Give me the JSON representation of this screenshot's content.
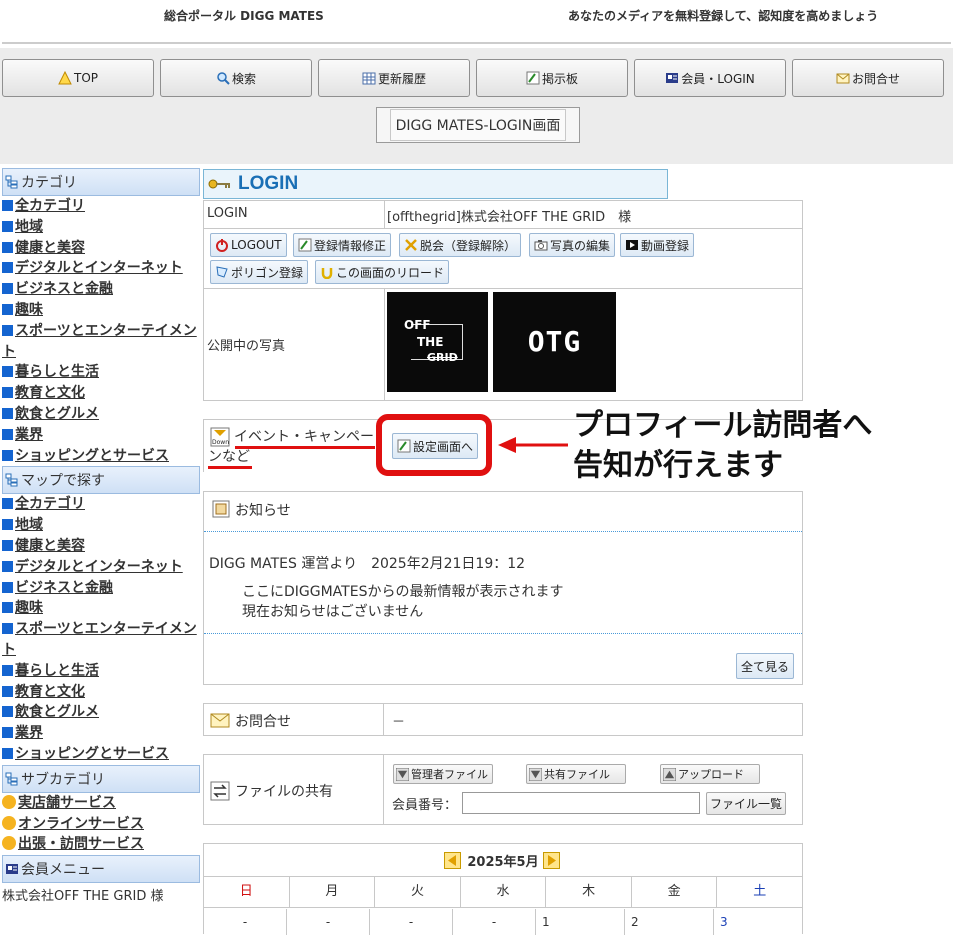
{
  "banner": {
    "left": "総合ポータル DIGG MATES",
    "right": "あなたのメディアを無料登録して、認知度を高めましょう"
  },
  "nav": [
    {
      "label": "TOP",
      "icon": "warning-triangle-icon"
    },
    {
      "label": "検索",
      "icon": "search-icon"
    },
    {
      "label": "更新履歴",
      "icon": "calendar-grid-icon"
    },
    {
      "label": "掲示板",
      "icon": "pencil-board-icon"
    },
    {
      "label": "会員・LOGIN",
      "icon": "id-card-icon"
    },
    {
      "label": "お問合せ",
      "icon": "envelope-icon"
    }
  ],
  "page_title": "DIGG MATES-LOGIN画面",
  "sidebar": {
    "category_head": "カテゴリ",
    "categories": [
      "全カテゴリ",
      "地域",
      "健康と美容",
      "デジタルとインターネット",
      "ビジネスと金融",
      "趣味",
      "スポーツとエンターテイメント",
      "暮らしと生活",
      "教育と文化",
      "飲食とグルメ",
      "業界",
      "ショッピングとサービス"
    ],
    "map_head": "マップで探す",
    "map_categories": [
      "全カテゴリ",
      "地域",
      "健康と美容",
      "デジタルとインターネット",
      "ビジネスと金融",
      "趣味",
      "スポーツとエンターテイメント",
      "暮らしと生活",
      "教育と文化",
      "飲食とグルメ",
      "業界",
      "ショッピングとサービス"
    ],
    "sub_head": "サブカテゴリ",
    "sub_categories": [
      "実店舗サービス",
      "オンラインサービス",
      "出張・訪問サービス"
    ],
    "member_head": "会員メニュー",
    "member_text": "株式会社OFF THE GRID 様"
  },
  "login": {
    "head": "LOGIN",
    "row_label": "LOGIN",
    "row_value": "[offthegrid]株式会社OFF THE GRID　様",
    "buttons": [
      "LOGOUT",
      "登録情報修正",
      "脱会（登録解除）",
      "写真の編集",
      "動画登録",
      "ポリゴン登録",
      "この画面のリロード"
    ],
    "photos_label": "公開中の写真",
    "photo1_text": [
      "OFF",
      "THE",
      "GRID"
    ],
    "photo2_text": "OTG"
  },
  "event": {
    "label": "イベント・キャンペーンなど",
    "label_line1": "イベント・キャンペー",
    "label_line2": "ンなど",
    "button": "設定画面へ",
    "callout_line1": "プロフィール訪問者へ",
    "callout_line2": "告知が行えます"
  },
  "notice": {
    "head": "お知らせ",
    "from": "DIGG MATES 運営より　2025年2月21日19：12",
    "line1": "ここにDIGGMATESからの最新情報が表示されます",
    "line2": "現在お知らせはございません",
    "more": "全て見る"
  },
  "contact": {
    "label": "お問合せ",
    "value": "－"
  },
  "files": {
    "label": "ファイルの共有",
    "admin": "管理者ファイル",
    "shared": "共有ファイル",
    "upload": "アップロード",
    "member_label": "会員番号：",
    "member_value": "",
    "list_button": "ファイル一覧"
  },
  "calendar": {
    "title": "2025年5月",
    "days": [
      "日",
      "月",
      "火",
      "水",
      "木",
      "金",
      "土"
    ],
    "row1": [
      "-",
      "-",
      "-",
      "-",
      "1",
      "2",
      "3"
    ]
  },
  "colors": {
    "accent_blue": "#1464d0",
    "highlight_red": "#e01010",
    "login_blue": "#1a6fb5"
  }
}
